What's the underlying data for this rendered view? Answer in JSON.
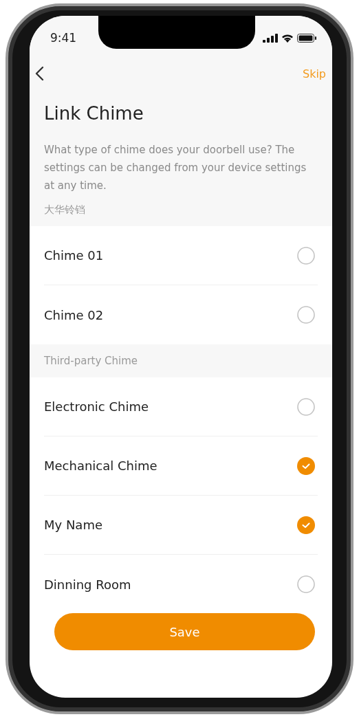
{
  "status_bar": {
    "time": "9:41"
  },
  "nav": {
    "action": "Skip"
  },
  "title": "Link Chime",
  "description": "What type of chime does your doorbell use? The settings can be changed from your device settings at any time.",
  "sections": [
    {
      "header": "大华铃铛",
      "items": [
        {
          "label": "Chime 01",
          "selected": false
        },
        {
          "label": "Chime 02",
          "selected": false
        }
      ]
    },
    {
      "header": "Third-party Chime",
      "items": [
        {
          "label": "Electronic Chime",
          "selected": false
        },
        {
          "label": "Mechanical Chime",
          "selected": true
        },
        {
          "label": "My Name",
          "selected": true
        },
        {
          "label": "Dinning Room",
          "selected": false
        }
      ]
    }
  ],
  "save_button": "Save"
}
